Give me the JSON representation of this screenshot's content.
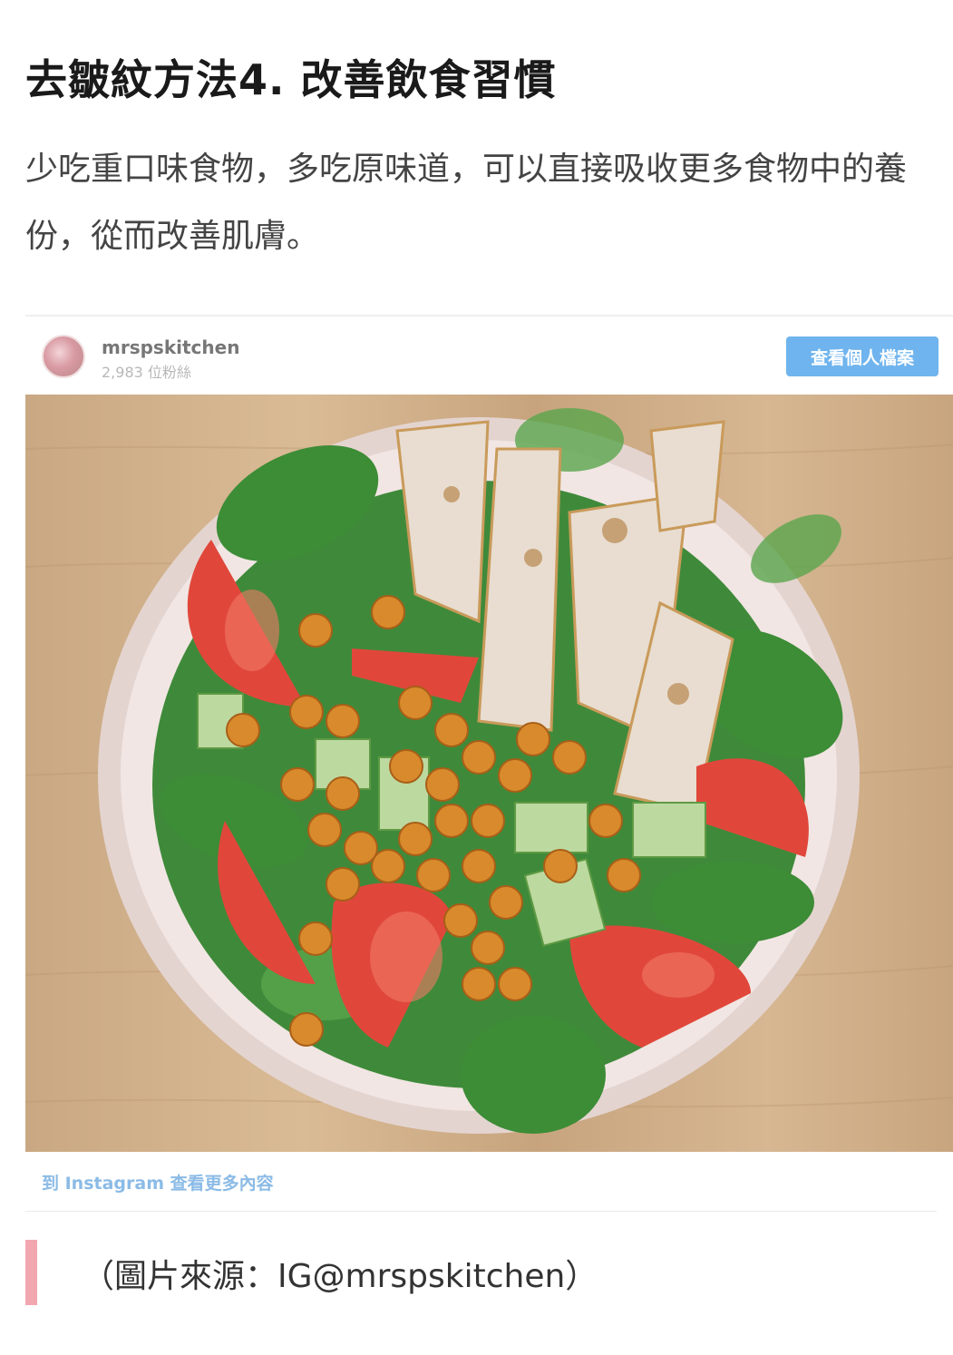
{
  "article": {
    "heading": "去皺紋方法4. 改善飲食習慣",
    "body": "少吃重口味食物，多吃原味道，可以直接吸收更多食物中的養份，從而改善肌膚。"
  },
  "embed": {
    "username": "mrspskitchen",
    "followers": "2,983 位粉絲",
    "view_profile_label": "查看個人檔案",
    "footer_link": "到 Instagram 查看更多內容",
    "image_subject": "salad bowl with chicken, tomato, chickpeas, cucumber and spinach"
  },
  "caption": "（圖片來源：IG@mrspskitchen）",
  "colors": {
    "button_bg": "#6fb4ee",
    "link": "#8bbbe6",
    "caption_accent": "#f2a6b0"
  }
}
